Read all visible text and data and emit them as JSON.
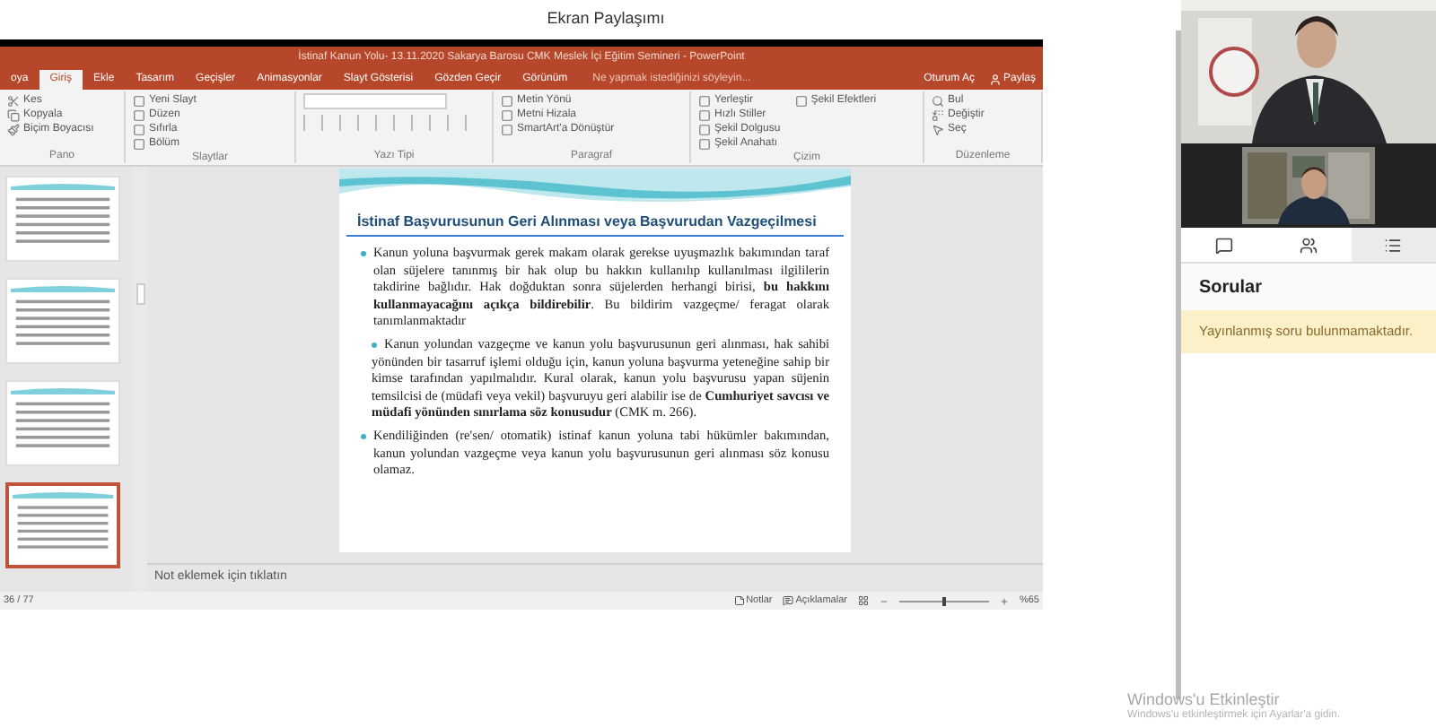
{
  "header": {
    "title": "Ekran Paylaşımı"
  },
  "powerpoint": {
    "title": "İstinaf Kanun Yolu- 13.11.2020 Sakarya Barosu CMK Meslek İçi Eğitim Semineri - PowerPoint",
    "tabs": [
      {
        "label": "oya",
        "selected": false
      },
      {
        "label": "Giriş",
        "selected": true
      },
      {
        "label": "Ekle",
        "selected": false
      },
      {
        "label": "Tasarım",
        "selected": false
      },
      {
        "label": "Geçişler",
        "selected": false
      },
      {
        "label": "Animasyonlar",
        "selected": false
      },
      {
        "label": "Slayt Gösterisi",
        "selected": false
      },
      {
        "label": "Gözden Geçir",
        "selected": false
      },
      {
        "label": "Görünüm",
        "selected": false
      }
    ],
    "tell_me": "Ne yapmak istediğinizi söyleyin...",
    "sign_in": "Oturum Aç",
    "share": "Paylaş",
    "ribbon_groups": [
      {
        "label": "Pano",
        "items": [
          "Kes",
          "Kopyala",
          "Biçim Boyacısı"
        ]
      },
      {
        "label": "Slaytlar",
        "items": [
          "Yeni Slayt",
          "Düzen",
          "Sıfırla",
          "Bölüm"
        ]
      },
      {
        "label": "Yazı Tipi"
      },
      {
        "label": "Paragraf",
        "items": [
          "Metin Yönü",
          "Metni Hizala",
          "SmartArt'a Dönüştür"
        ]
      },
      {
        "label": "Çizim",
        "items": [
          "Yerleştir",
          "Hızlı Stiller",
          "Şekil Dolgusu",
          "Şekil Anahatı",
          "Şekil Efektleri"
        ]
      },
      {
        "label": "Düzenleme",
        "items": [
          "Bul",
          "Değiştir",
          "Seç"
        ]
      }
    ],
    "thumbnails": [
      {
        "selected": false
      },
      {
        "selected": false
      },
      {
        "selected": false
      },
      {
        "selected": true
      }
    ],
    "slide": {
      "title": "İstinaf Başvurusunun Geri Alınması veya Başvurudan Vazgeçilmesi",
      "bullets": [
        {
          "kind": "main",
          "text": "Kanun yoluna başvurmak gerek makam olarak gerekse uyuşmazlık bakımından taraf olan süjelere tanınmış bir hak olup bu hakkın kullanılıp kullanılması ilgililerin takdirine bağlıdır. Hak doğduktan sonra süjelerden herhangi birisi, **bu hakkını kullanmayacağını açıkça bildirebilir**. Bu bildirim vazgeçme/ feragat olarak tanımlanmaktadır"
        },
        {
          "kind": "sub",
          "text": "Kanun yolundan vazgeçme ve kanun yolu başvurusunun geri alınması, hak sahibi yönünden bir tasarruf işlemi olduğu için, kanun yoluna başvurma yeteneğine sahip bir kimse tarafından yapılmalıdır. Kural olarak, kanun yolu başvurusu yapan süjenin temsilcisi de (müdafi veya vekil) başvuruyu geri alabilir ise de **Cumhuriyet savcısı ve müdafi yönünden sınırlama söz konusudur** (CMK m. 266)."
        },
        {
          "kind": "main",
          "text": "Kendiliğinden (re'sen/ otomatik) istinaf kanun yoluna tabi hükümler bakımından, kanun yolundan vazgeçme veya kanun yolu başvurusunun geri alınması söz konusu olamaz."
        }
      ]
    },
    "notes_placeholder": "Not eklemek için tıklatın",
    "status_bar": {
      "slide_counter": "36 / 77",
      "notes": "Notlar",
      "comments": "Açıklamalar",
      "zoom": "%65",
      "zoom_slider": {
        "level": 0.5
      }
    }
  },
  "meeting": {
    "tabs": [
      {
        "kind": "chat",
        "selected": false
      },
      {
        "kind": "people",
        "selected": false
      },
      {
        "kind": "questions",
        "selected": true
      }
    ],
    "questions_title": "Sorular",
    "empty_notice": "Yayınlanmış soru bulunmamaktadır."
  },
  "activation_notice": {
    "title": "Windows'u Etkinleştir",
    "subtitle": "Windows'u etkinleştirmek için Ayarlar'a gidin."
  }
}
